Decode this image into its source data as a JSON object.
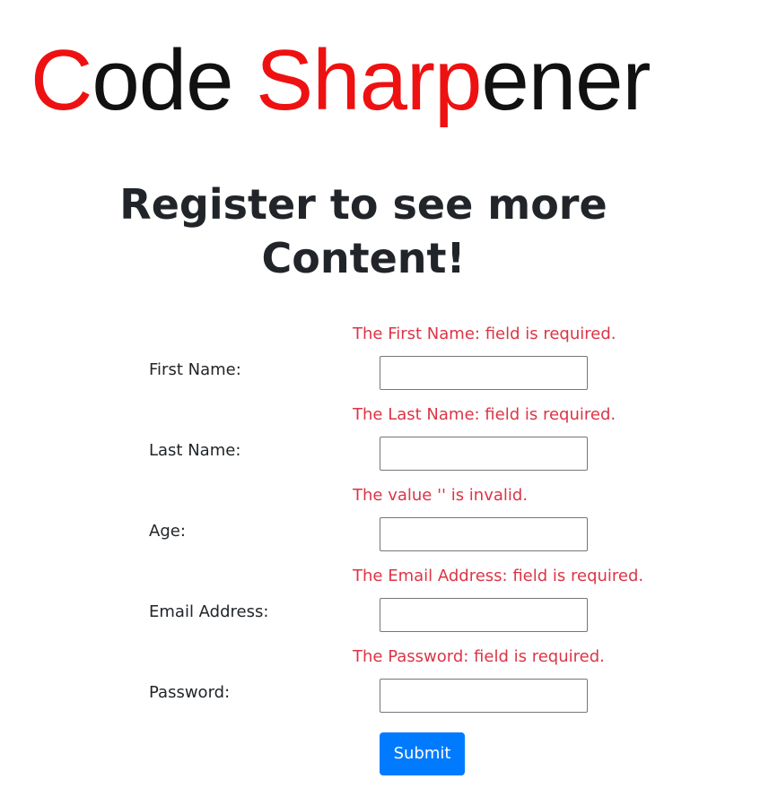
{
  "logo": {
    "parts": [
      "C",
      "ode ",
      "Sharp",
      "ener"
    ],
    "colors": {
      "red": "#ee1111",
      "black": "#111111"
    }
  },
  "heading": {
    "line1": "Register to see more",
    "line2": "Content!"
  },
  "form": {
    "fields": [
      {
        "label": "First Name:",
        "error": "The First Name: field is required.",
        "value": ""
      },
      {
        "label": "Last Name:",
        "error": "The Last Name: field is required.",
        "value": ""
      },
      {
        "label": "Age:",
        "error": "The value '' is invalid.",
        "value": ""
      },
      {
        "label": "Email Address:",
        "error": "The Email Address: field is required.",
        "value": ""
      },
      {
        "label": "Password:",
        "error": "The Password: field is required.",
        "value": ""
      }
    ],
    "submit_label": "Submit"
  },
  "colors": {
    "error": "#dc3545",
    "primary": "#007bff",
    "text": "#212529"
  }
}
